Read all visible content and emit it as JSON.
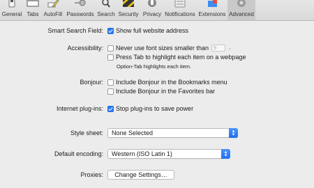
{
  "toolbar": {
    "tabs": [
      {
        "label": "General",
        "icon": "general-switch-icon"
      },
      {
        "label": "Tabs",
        "icon": "tabs-icon"
      },
      {
        "label": "AutoFill",
        "icon": "pencil-icon"
      },
      {
        "label": "Passwords",
        "icon": "key-icon"
      },
      {
        "label": "Search",
        "icon": "magnifier-icon"
      },
      {
        "label": "Security",
        "icon": "security-tape-icon"
      },
      {
        "label": "Privacy",
        "icon": "hand-icon"
      },
      {
        "label": "Notifications",
        "icon": "notifications-icon"
      },
      {
        "label": "Extensions",
        "icon": "puzzle-icon"
      },
      {
        "label": "Advanced",
        "icon": "gear-icon"
      }
    ],
    "active": "Advanced"
  },
  "smart_search": {
    "label": "Smart Search Field:",
    "show_full_address": {
      "label": "Show full website address",
      "checked": true
    }
  },
  "accessibility": {
    "label": "Accessibility:",
    "min_font": {
      "label": "Never use font sizes smaller than",
      "checked": false,
      "value": "9"
    },
    "tab_highlight": {
      "label": "Press Tab to highlight each item on a webpage",
      "checked": false
    },
    "hint": "Option-Tab highlights each item."
  },
  "bonjour": {
    "label": "Bonjour:",
    "bookmarks_menu": {
      "label": "Include Bonjour in the Bookmarks menu",
      "checked": false
    },
    "favorites_bar": {
      "label": "Include Bonjour in the Favorites bar",
      "checked": false
    }
  },
  "plugins": {
    "label": "Internet plug-ins:",
    "stop_plugins": {
      "label": "Stop plug-ins to save power",
      "checked": true
    }
  },
  "style_sheet": {
    "label": "Style sheet:",
    "value": "None Selected"
  },
  "encoding": {
    "label": "Default encoding:",
    "value": "Western (ISO Latin 1)"
  },
  "proxies": {
    "label": "Proxies:",
    "button": "Change Settings…"
  },
  "colors": {
    "accent": "#2c7cf6"
  }
}
